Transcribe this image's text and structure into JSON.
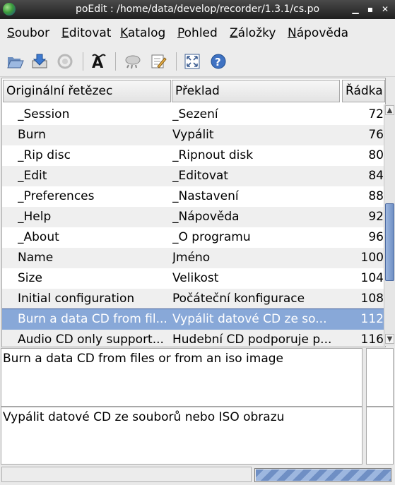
{
  "window": {
    "title": "poEdit : /home/data/develop/recorder/1.3.1/cs.po"
  },
  "menu": [
    {
      "label": "Soubor"
    },
    {
      "label": "Editovat"
    },
    {
      "label": "Katalog"
    },
    {
      "label": "Pohled"
    },
    {
      "label": "Záložky"
    },
    {
      "label": "Nápověda"
    }
  ],
  "toolbar": {
    "buttons": [
      "open-icon",
      "save-icon",
      "update-catalog-icon",
      "fuzzy-icon",
      "comments-icon",
      "edit-comment-icon",
      "fullscreen-icon",
      "help-icon"
    ]
  },
  "list": {
    "columns": [
      "Originální řetězec",
      "Překlad",
      "Řádka"
    ],
    "rows": [
      {
        "source": "_Session",
        "translation": "_Sezení",
        "line": "72"
      },
      {
        "source": "Burn",
        "translation": "Vypálit",
        "line": "76"
      },
      {
        "source": "_Rip disc",
        "translation": "_Ripnout disk",
        "line": "80"
      },
      {
        "source": "_Edit",
        "translation": "_Editovat",
        "line": "84"
      },
      {
        "source": "_Preferences",
        "translation": "_Nastavení",
        "line": "88"
      },
      {
        "source": "_Help",
        "translation": "_Nápověda",
        "line": "92"
      },
      {
        "source": "_About",
        "translation": "_O programu",
        "line": "96"
      },
      {
        "source": "Name",
        "translation": "Jméno",
        "line": "100"
      },
      {
        "source": "Size",
        "translation": "Velikost",
        "line": "104"
      },
      {
        "source": "Initial configuration",
        "translation": "Počáteční konfigurace",
        "line": "108"
      },
      {
        "source": "Burn a data CD from fil...",
        "translation": "Vypálit datové CD ze so...",
        "line": "112"
      },
      {
        "source": "Audio CD only support...",
        "translation": "Hudební CD podporuje p...",
        "line": "116"
      }
    ],
    "selected_index": 10
  },
  "source_text": "Burn a data CD from files or from an iso image",
  "translation_text": "Vypálit datové CD ze souborů nebo ISO obrazu",
  "progress": {
    "value": 1.0
  }
}
